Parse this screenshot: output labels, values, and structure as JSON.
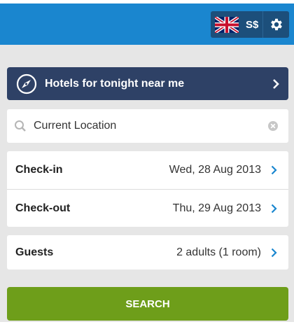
{
  "header": {
    "currency": "S$",
    "flag_icon": "uk-flag-icon",
    "settings_icon": "gear-icon",
    "colors": {
      "bar": "#1a86cf",
      "controls": "#1c4f7b"
    }
  },
  "nearby": {
    "label": "Hotels for tonight near me",
    "icon": "compass-icon",
    "color": "#2e4166"
  },
  "location": {
    "value": "Current Location",
    "placeholder": "Current Location",
    "search_icon": "search-icon",
    "clear_icon": "clear-icon"
  },
  "dates": {
    "checkin_label": "Check-in",
    "checkin_value": "Wed, 28 Aug 2013",
    "checkout_label": "Check-out",
    "checkout_value": "Thu, 29 Aug 2013"
  },
  "guests": {
    "label": "Guests",
    "value": "2 adults (1 room)"
  },
  "search": {
    "label": "SEARCH",
    "color": "#6e9e1a"
  },
  "accent": "#1a86cf"
}
